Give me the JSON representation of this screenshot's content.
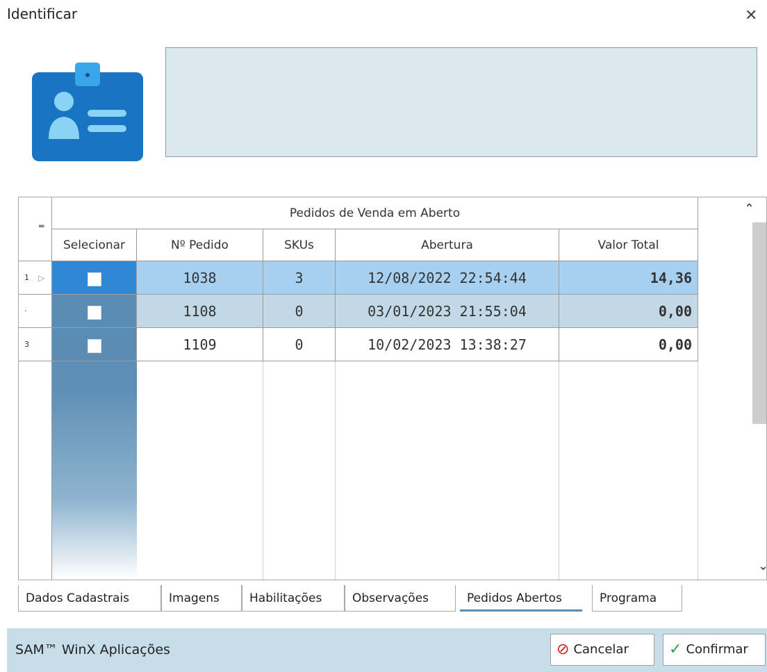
{
  "window": {
    "title": "Identificar",
    "close_icon": "close-icon"
  },
  "grid": {
    "band_title": "Pedidos de Venda em Aberto",
    "columns": [
      "Selecionar",
      "Nº Pedido",
      "SKUs",
      "Abertura",
      "Valor Total"
    ],
    "rows": [
      {
        "indicator": "1",
        "selected": false,
        "pedido": "1038",
        "skus": "3",
        "abertura": "12/08/2022 22:54:44",
        "valor": "14,36"
      },
      {
        "indicator": "·",
        "selected": false,
        "pedido": "1108",
        "skus": "0",
        "abertura": "03/01/2023 21:55:04",
        "valor": "0,00"
      },
      {
        "indicator": "3",
        "selected": false,
        "pedido": "1109",
        "skus": "0",
        "abertura": "10/02/2023 13:38:27",
        "valor": "0,00"
      }
    ]
  },
  "tabs": [
    "Dados Cadastrais",
    "Imagens",
    "Habilitações",
    "Observações",
    "Pedidos Abertos",
    "Programa"
  ],
  "active_tab": "Pedidos Abertos",
  "footer": {
    "brand": "SAM™ WinX Aplicações",
    "cancel_label": "Cancelar",
    "confirm_label": "Confirmar"
  },
  "colors": {
    "accent": "#5b8db4",
    "row_highlight": "#a7d0f0",
    "row_alt": "#c2d8e6",
    "footer": "#c7dde8"
  }
}
